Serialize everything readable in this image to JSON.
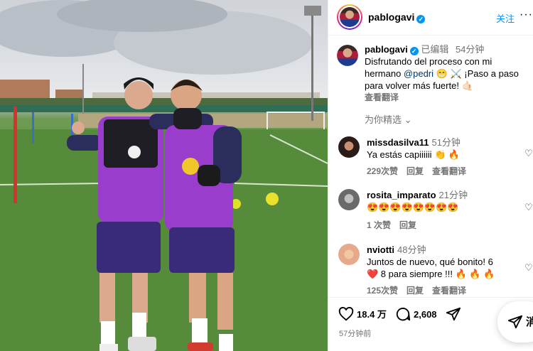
{
  "post": {
    "username": "pablogavi",
    "follow_label": "关注",
    "more_label": "···",
    "edited_label": "已编辑",
    "caption_time": "54分钟",
    "caption_line1": "Disfrutando del proceso con mi",
    "caption_line2_pre": "hermano ",
    "mention": "@pedri",
    "caption_line2_post": " 😁 ⚔️ ¡Paso a paso",
    "caption_line3": "para volver más fuerte! 🤙🏻",
    "translate_label": "查看翻译",
    "for_you_label": "为你精选 ⌄"
  },
  "comments": [
    {
      "user": "missdasilva11",
      "time": "51分钟",
      "text_line1": "Ya estás capiiiiii 👏 🔥",
      "text_line2": "",
      "likes": "229次赞",
      "reply": "回复",
      "translate": "查看翻译"
    },
    {
      "user": "rosita_imparato",
      "time": "21分钟",
      "text_line1": "😍😍😍😍😍😍😍😍",
      "text_line2": "",
      "likes": "1 次赞",
      "reply": "回复",
      "translate": ""
    },
    {
      "user": "nviotti",
      "time": "48分钟",
      "text_line1": "Juntos de nuevo, qué bonito! 6",
      "text_line2": "❤️ 8 para siempre !!! 🔥 🔥 🔥",
      "likes": "125次赞",
      "reply": "回复",
      "translate": "查看翻译"
    }
  ],
  "actions": {
    "likes": "18.4 万",
    "comments": "2,608",
    "posted": "57分钟前",
    "message_label": "消"
  },
  "colors": {
    "accent": "#0095f6",
    "muted": "#737373",
    "jersey": "#9b3dcc"
  }
}
